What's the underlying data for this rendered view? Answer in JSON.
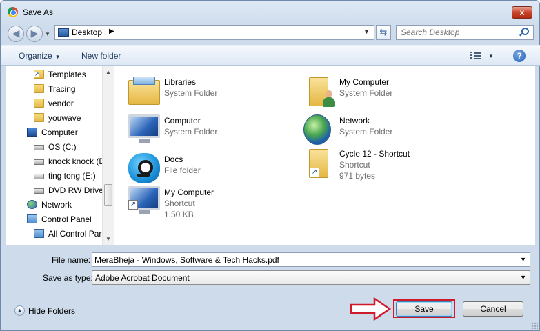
{
  "window": {
    "title": "Save As",
    "close_label": "x"
  },
  "address": {
    "location": "Desktop",
    "chevron": "▶"
  },
  "search": {
    "placeholder": "Search Desktop"
  },
  "toolbar": {
    "organize_label": "Organize",
    "new_folder_label": "New folder",
    "help_label": "?"
  },
  "navpane": {
    "items": [
      {
        "label": "Templates",
        "icon": "folder-shortcut-icon"
      },
      {
        "label": "Tracing",
        "icon": "folder-icon"
      },
      {
        "label": "vendor",
        "icon": "folder-icon"
      },
      {
        "label": "youwave",
        "icon": "folder-icon"
      },
      {
        "label": "Computer",
        "icon": "computer-icon"
      },
      {
        "label": "OS (C:)",
        "icon": "drive-icon"
      },
      {
        "label": "knock knock (D",
        "icon": "drive-icon"
      },
      {
        "label": "ting tong (E:)",
        "icon": "drive-icon"
      },
      {
        "label": "DVD RW Drive",
        "icon": "dvd-drive-icon"
      },
      {
        "label": "Network",
        "icon": "network-icon"
      },
      {
        "label": "Control Panel",
        "icon": "control-panel-icon"
      },
      {
        "label": "All Control Par",
        "icon": "control-panel-icon"
      }
    ]
  },
  "files": [
    {
      "name": "Libraries",
      "line1": "System Folder",
      "line2": "",
      "icon": "libraries-icon"
    },
    {
      "name": "My Computer",
      "line1": "System Folder",
      "line2": "",
      "icon": "user-folder-icon"
    },
    {
      "name": "Computer",
      "line1": "System Folder",
      "line2": "",
      "icon": "computer-icon"
    },
    {
      "name": "Network",
      "line1": "System Folder",
      "line2": "",
      "icon": "network-icon"
    },
    {
      "name": "Docs",
      "line1": "File folder",
      "line2": "",
      "icon": "monster-folder-icon"
    },
    {
      "name": "Cycle 12 - Shortcut",
      "line1": "Shortcut",
      "line2": "971 bytes",
      "icon": "folder-shortcut-icon"
    },
    {
      "name": "My Computer",
      "line1": "Shortcut",
      "line2": "1.50 KB",
      "icon": "computer-shortcut-icon"
    }
  ],
  "form": {
    "file_name_label": "File name:",
    "file_name_value": "MeraBheja - Windows, Software & Tech Hacks.pdf",
    "save_type_label": "Save as type:",
    "save_type_value": "Adobe Acrobat Document"
  },
  "footer": {
    "hide_folders_label": "Hide Folders",
    "save_label": "Save",
    "cancel_label": "Cancel"
  },
  "colors": {
    "highlight_red": "#d0192b",
    "accent_blue": "#2d62a8"
  }
}
